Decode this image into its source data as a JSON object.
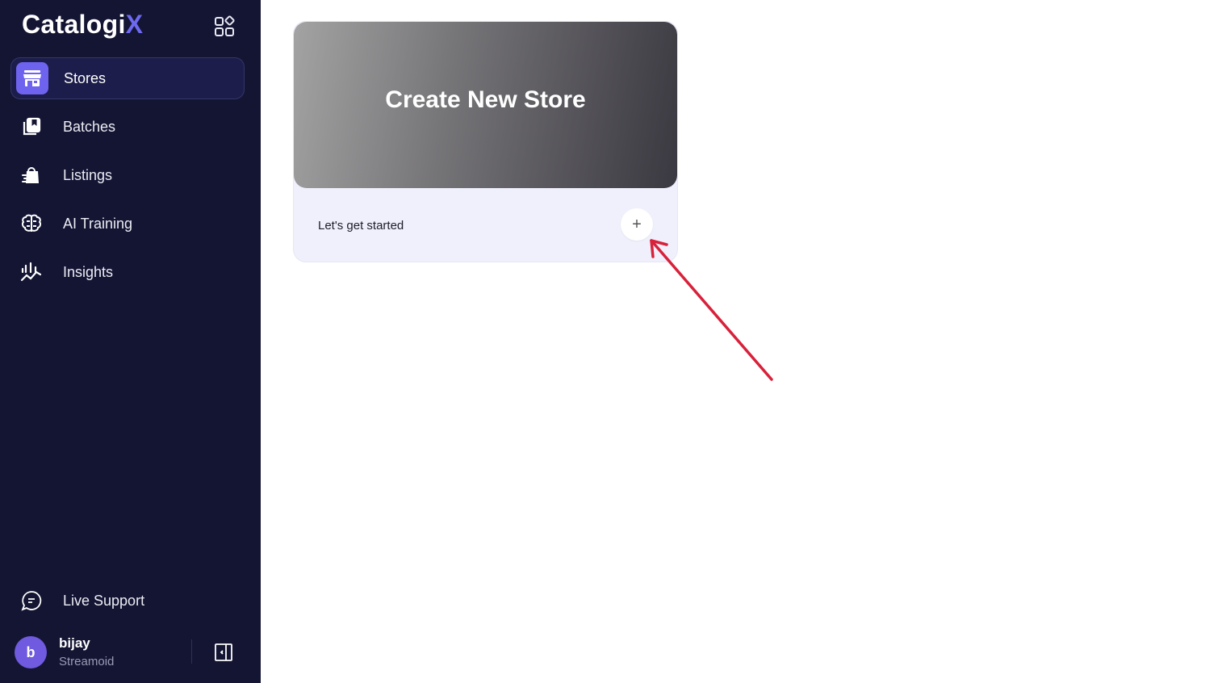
{
  "brand": {
    "logo_main": "Catalogi",
    "logo_accent": "X",
    "accent_color": "#6d6af0"
  },
  "sidebar": {
    "apps_icon": "grid-icon",
    "items": [
      {
        "label": "Stores",
        "icon": "store-icon",
        "active": true
      },
      {
        "label": "Batches",
        "icon": "batches-icon",
        "active": false
      },
      {
        "label": "Listings",
        "icon": "shopping-bag-icon",
        "active": false
      },
      {
        "label": "AI Training",
        "icon": "brain-icon",
        "active": false
      },
      {
        "label": "Insights",
        "icon": "chart-icon",
        "active": false
      }
    ],
    "support": {
      "label": "Live Support",
      "icon": "chat-icon"
    },
    "user": {
      "initial": "b",
      "name": "bijay",
      "org": "Streamoid"
    },
    "collapse_icon": "sidebar-collapse-icon"
  },
  "main": {
    "card": {
      "title": "Create New Store",
      "subtitle": "Let's get started",
      "add_symbol": "+"
    }
  },
  "annotation": {
    "color": "#d8213a"
  }
}
